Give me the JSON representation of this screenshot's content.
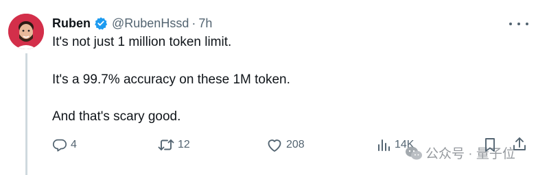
{
  "tweet": {
    "author": {
      "name": "Ruben",
      "handle": "@RubenHssd",
      "separator": "·",
      "time": "7h",
      "verified": true
    },
    "lines": [
      "It's not just 1 million token limit.",
      "It's a 99.7% accuracy on these 1M token.",
      "And that's scary good."
    ],
    "actions": {
      "reply_count": "4",
      "retweet_count": "12",
      "like_count": "208",
      "views_count": "14K"
    }
  },
  "watermark": {
    "text": "公众号 · 量子位"
  },
  "icons": {
    "reply": "reply-icon",
    "retweet": "retweet-icon",
    "like": "heart-icon",
    "views": "views-icon",
    "bookmark": "bookmark-icon",
    "share": "share-icon",
    "more": "more-icon",
    "verified": "verified-badge-icon"
  },
  "colors": {
    "text": "#0f1419",
    "secondary": "#536471",
    "verified": "#1d9bf0",
    "avatar_bg": "#d32f4a",
    "thread_line": "#cfd9de"
  }
}
